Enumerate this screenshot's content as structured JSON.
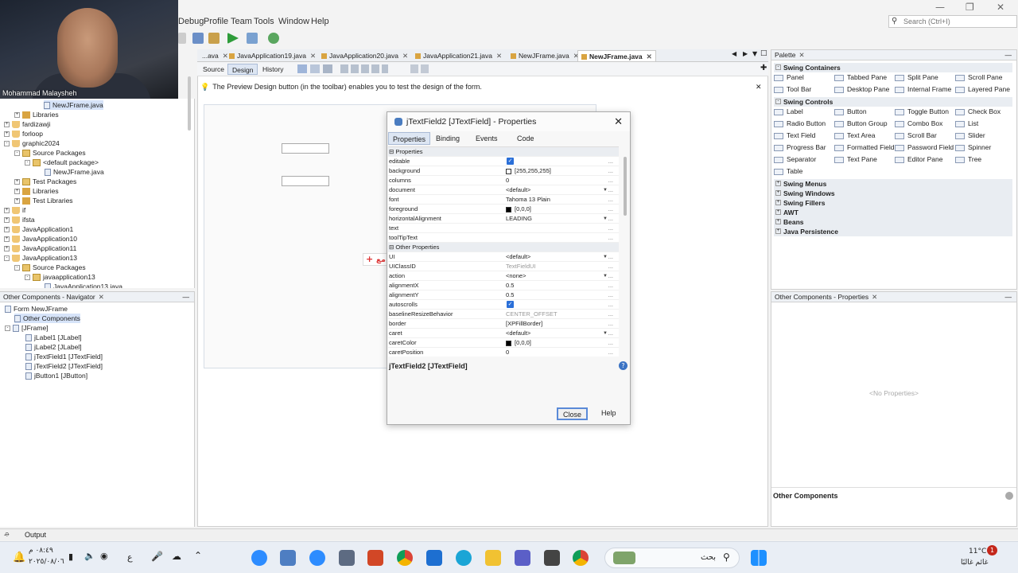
{
  "webcam": {
    "name": "Mohammad Malaysheh"
  },
  "menu": [
    "Debug",
    "Profile",
    "Team",
    "Tools",
    "Window",
    "Help"
  ],
  "search": {
    "placeholder": "Search (Ctrl+I)"
  },
  "editor_tabs": [
    {
      "label": "...ava"
    },
    {
      "label": "JavaApplication19.java"
    },
    {
      "label": "JavaApplication20.java"
    },
    {
      "label": "JavaApplication21.java"
    },
    {
      "label": "NewJFrame.java"
    },
    {
      "label": "NewJFrame.java",
      "active": true
    }
  ],
  "design_tabs": {
    "source": "Source",
    "design": "Design",
    "history": "History"
  },
  "hint": "The Preview Design button (in the toolbar) enables you to test the design of the form.",
  "projects_tree": [
    {
      "label": "NewJFrame.java",
      "indent": 55,
      "type": "file",
      "selected": true
    },
    {
      "label": "Libraries",
      "indent": 30,
      "type": "lib",
      "exp": "+"
    },
    {
      "label": "fardizawji",
      "indent": 17,
      "type": "cup",
      "exp": "+"
    },
    {
      "label": "forloop",
      "indent": 17,
      "type": "cup",
      "exp": "+"
    },
    {
      "label": "graphic2024",
      "indent": 17,
      "type": "cup",
      "exp": "-"
    },
    {
      "label": "Source Packages",
      "indent": 30,
      "type": "pkg",
      "exp": "-"
    },
    {
      "label": "<default package>",
      "indent": 43,
      "type": "pkg",
      "exp": "-"
    },
    {
      "label": "NewJFrame.java",
      "indent": 56,
      "type": "file"
    },
    {
      "label": "Test Packages",
      "indent": 30,
      "type": "pkg",
      "exp": "+"
    },
    {
      "label": "Libraries",
      "indent": 30,
      "type": "lib",
      "exp": "+"
    },
    {
      "label": "Test Libraries",
      "indent": 30,
      "type": "lib",
      "exp": "+"
    },
    {
      "label": "if",
      "indent": 17,
      "type": "cup",
      "exp": "+"
    },
    {
      "label": "ifsta",
      "indent": 17,
      "type": "cup",
      "exp": "+"
    },
    {
      "label": "JavaApplication1",
      "indent": 17,
      "type": "cup",
      "exp": "+"
    },
    {
      "label": "JavaApplication10",
      "indent": 17,
      "type": "cup",
      "exp": "+"
    },
    {
      "label": "JavaApplication11",
      "indent": 17,
      "type": "cup",
      "exp": "+"
    },
    {
      "label": "JavaApplication13",
      "indent": 17,
      "type": "cup",
      "exp": "-"
    },
    {
      "label": "Source Packages",
      "indent": 30,
      "type": "pkg",
      "exp": "-"
    },
    {
      "label": "javaapplication13",
      "indent": 43,
      "type": "pkg",
      "exp": "-"
    },
    {
      "label": "JavaApplication13.java",
      "indent": 56,
      "type": "file"
    }
  ],
  "navigator": {
    "title": "Other Components - Navigator",
    "items": [
      {
        "label": "Form NewJFrame",
        "indent": 6
      },
      {
        "label": "Other Components",
        "indent": 18,
        "selected": true
      },
      {
        "label": "[JFrame]",
        "indent": 18,
        "exp": "-"
      },
      {
        "label": "jLabel1 [JLabel]",
        "indent": 32
      },
      {
        "label": "jLabel2 [JLabel]",
        "indent": 32
      },
      {
        "label": "jTextField1 [JTextField]",
        "indent": 32
      },
      {
        "label": "jTextField2 [JTextField]",
        "indent": 32
      },
      {
        "label": "jButton1 [JButton]",
        "indent": 32
      }
    ]
  },
  "dialog": {
    "title": "jTextField2 [JTextField] - Properties",
    "tabs": [
      "Properties",
      "Binding",
      "Events",
      "Code"
    ],
    "rows": [
      {
        "cat": "Properties"
      },
      {
        "k": "editable",
        "check": true
      },
      {
        "k": "background",
        "swatch": "#ffffff",
        "v": "[255,255,255]"
      },
      {
        "k": "columns",
        "v": "0"
      },
      {
        "k": "document",
        "v": "<default>",
        "dd": true
      },
      {
        "k": "font",
        "v": "Tahoma 13 Plain"
      },
      {
        "k": "foreground",
        "swatch": "#000000",
        "v": "[0,0,0]"
      },
      {
        "k": "horizontalAlignment",
        "v": "LEADING",
        "dd": true
      },
      {
        "k": "text",
        "v": ""
      },
      {
        "k": "toolTipText",
        "v": ""
      },
      {
        "cat": "Other Properties"
      },
      {
        "k": "UI",
        "v": "<default>",
        "dd": true
      },
      {
        "k": "UIClassID",
        "v": "TextFieldUI",
        "grey": true
      },
      {
        "k": "action",
        "v": "<none>",
        "dd": true
      },
      {
        "k": "alignmentX",
        "v": "0.5"
      },
      {
        "k": "alignmentY",
        "v": "0.5"
      },
      {
        "k": "autoscrolls",
        "check": true
      },
      {
        "k": "baselineResizeBehavior",
        "v": "CENTER_OFFSET",
        "grey": true
      },
      {
        "k": "border",
        "v": "[XPFillBorder]"
      },
      {
        "k": "caret",
        "v": "<default>",
        "dd": true
      },
      {
        "k": "caretColor",
        "swatch": "#000000",
        "v": "[0,0,0]"
      },
      {
        "k": "caretPosition",
        "v": "0"
      }
    ],
    "footer_label": "jTextField2 [JTextField]",
    "close_btn": "Close",
    "help_btn": "Help"
  },
  "palette": {
    "title": "Palette",
    "sections": [
      {
        "label": "Swing Containers",
        "open": true
      },
      {
        "label": "Swing Controls",
        "open": true
      },
      {
        "label": "Swing Menus"
      },
      {
        "label": "Swing Windows"
      },
      {
        "label": "Swing Fillers"
      },
      {
        "label": "AWT"
      },
      {
        "label": "Beans"
      },
      {
        "label": "Java Persistence"
      }
    ],
    "containers": [
      "Panel",
      "Tabbed Pane",
      "Split Pane",
      "Scroll Pane",
      "Tool Bar",
      "Desktop Pane",
      "Internal Frame",
      "Layered Pane"
    ],
    "controls": [
      "Label",
      "Button",
      "Toggle Button",
      "Check Box",
      "Radio Button",
      "Button Group",
      "Combo Box",
      "List",
      "Text Field",
      "Text Area",
      "Scroll Bar",
      "Slider",
      "Progress Bar",
      "Formatted Field",
      "Password Field",
      "Spinner",
      "Separator",
      "Text Pane",
      "Editor Pane",
      "Tree",
      "Table"
    ]
  },
  "props_panel": {
    "title": "Other Components - Properties",
    "empty": "<No Properties>",
    "footer": "Other Components"
  },
  "status": {
    "output": "Output"
  },
  "taskbar": {
    "time": "٠٨:٤٩ م",
    "date": "٢٠٢٥/٠٨/٠٦",
    "lang": "ع",
    "search": "بحث",
    "temp": "11°C",
    "weather": "غائم غالبًا",
    "badge": "1"
  }
}
